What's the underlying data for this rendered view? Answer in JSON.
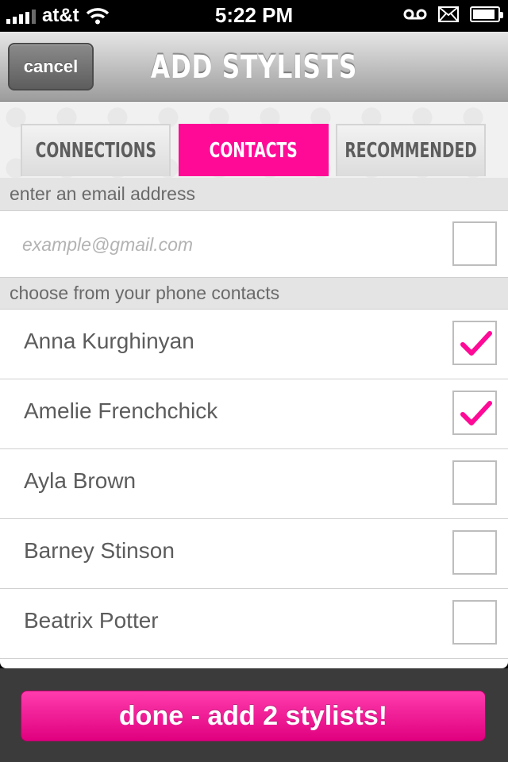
{
  "status_bar": {
    "carrier": "at&t",
    "time": "5:22 PM",
    "battery_level": 0.9
  },
  "header": {
    "cancel_label": "cancel",
    "title": "ADD STYLISTS"
  },
  "tabs": [
    {
      "label": "CONNECTIONS",
      "active": false
    },
    {
      "label": "CONTACTS",
      "active": true
    },
    {
      "label": "RECOMMENDED",
      "active": false
    }
  ],
  "email_section": {
    "header": "enter an email address",
    "placeholder": "example@gmail.com",
    "value": "",
    "checked": false
  },
  "contacts_section": {
    "header": "choose from your phone contacts",
    "contacts": [
      {
        "name": "Anna Kurghinyan",
        "checked": true
      },
      {
        "name": "Amelie Frenchchick",
        "checked": true
      },
      {
        "name": "Ayla Brown",
        "checked": false
      },
      {
        "name": "Barney Stinson",
        "checked": false
      },
      {
        "name": "Beatrix Potter",
        "checked": false
      }
    ]
  },
  "done_button": {
    "label": "done - add 2 stylists!"
  },
  "colors": {
    "accent": "#ff0a97",
    "check": "#ff0a97"
  },
  "icons": [
    "signal-bars-icon",
    "wifi-icon",
    "voicemail-icon",
    "mail-icon",
    "battery-icon",
    "checkmark-icon"
  ]
}
